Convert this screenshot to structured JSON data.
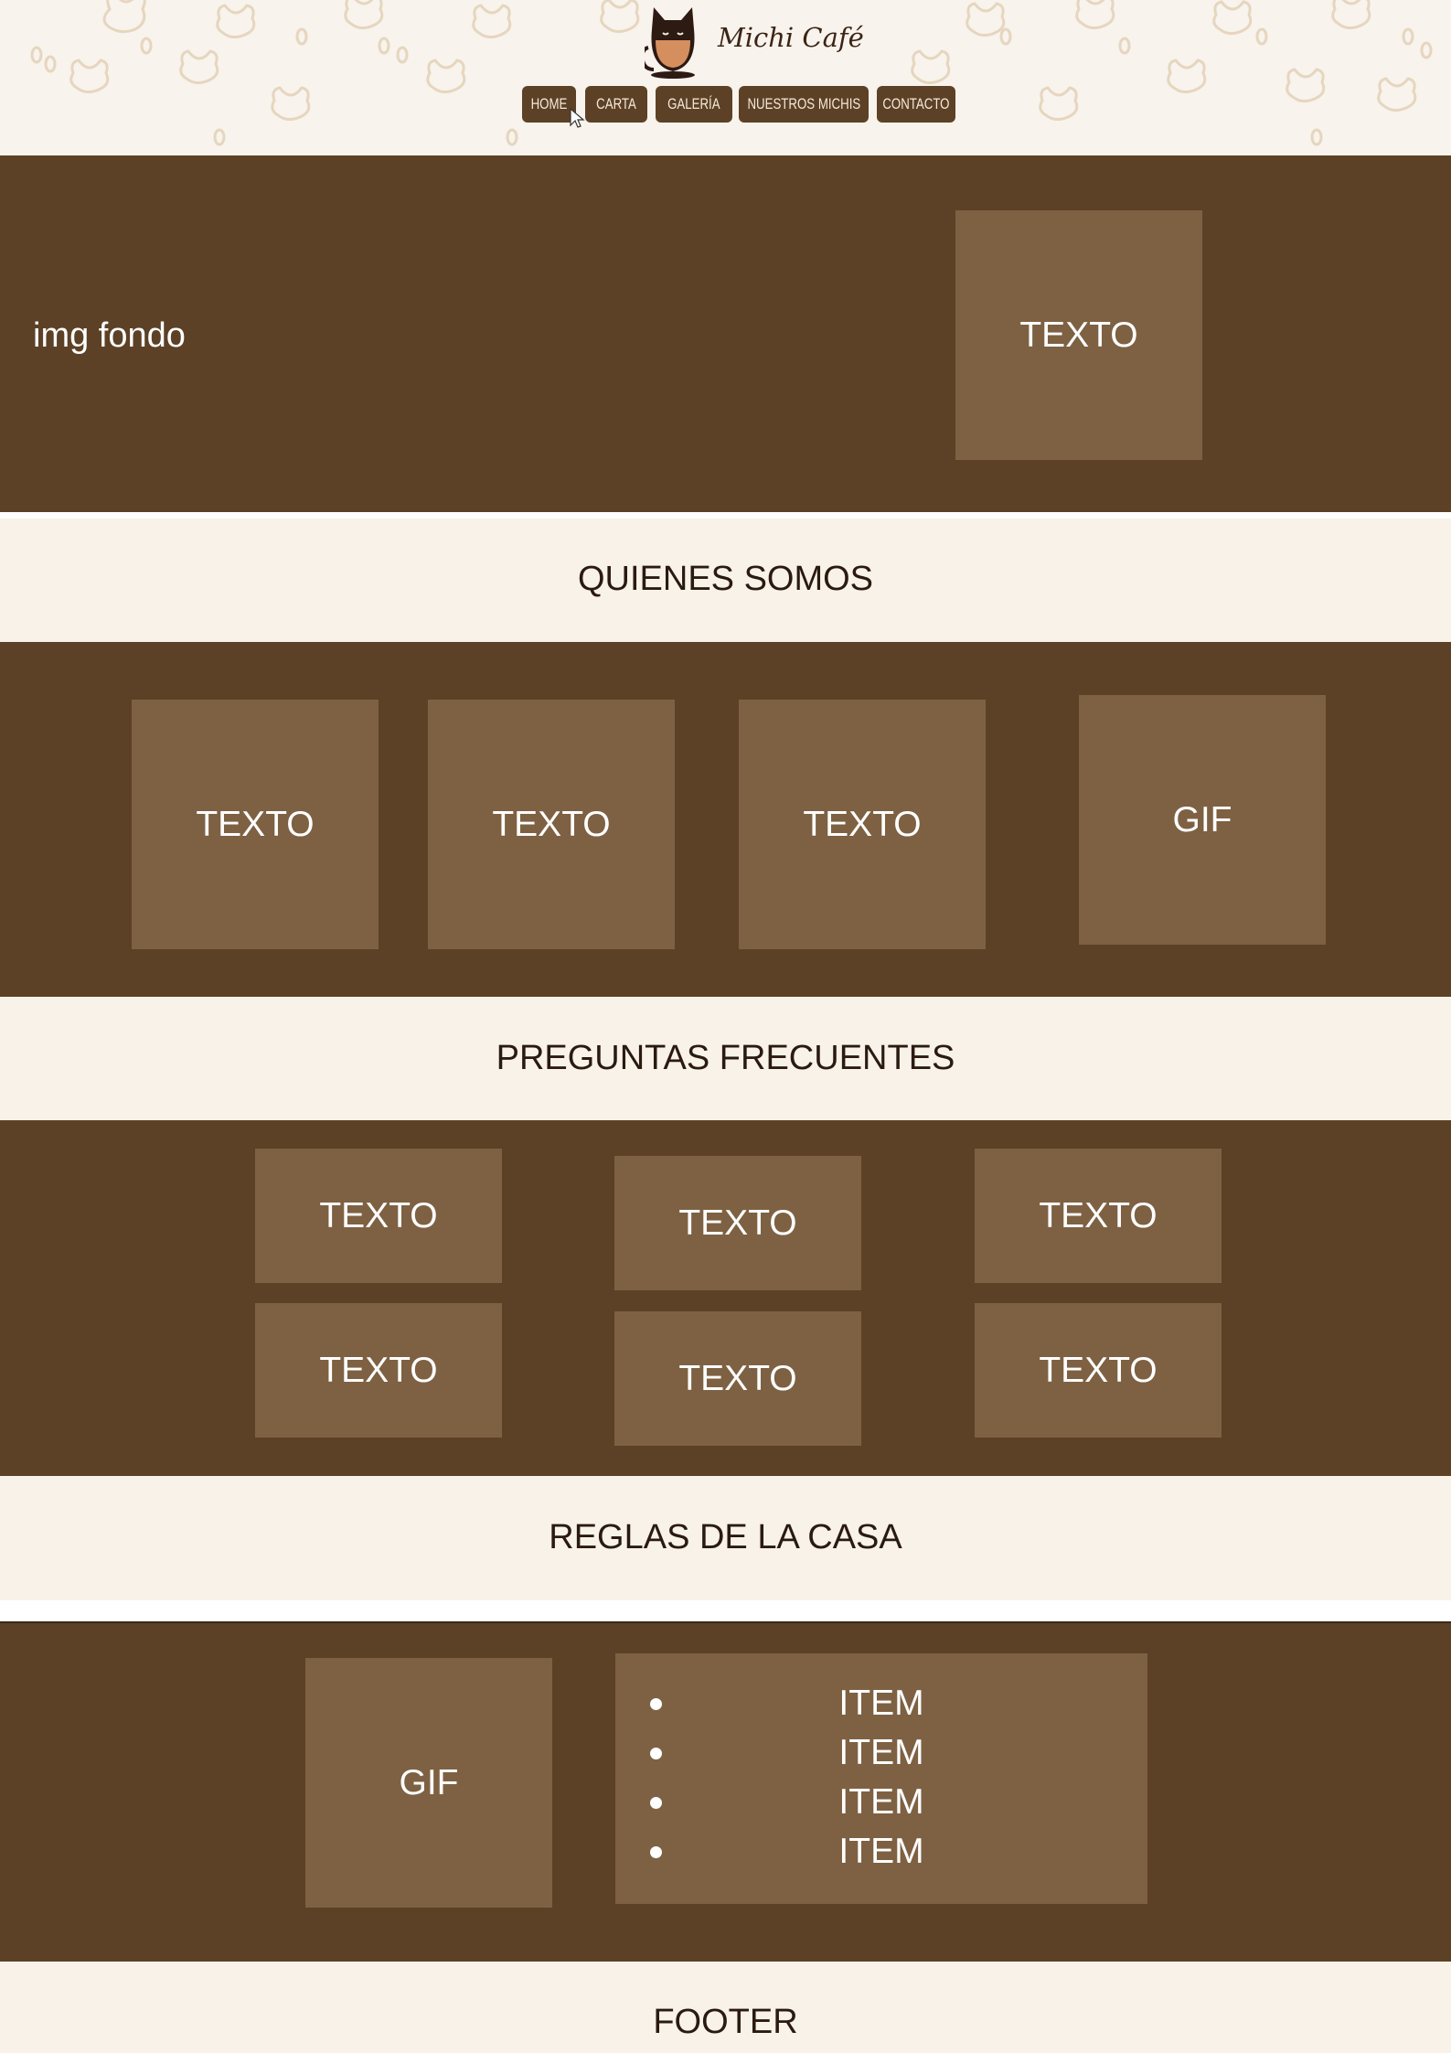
{
  "header": {
    "brand": "Michi Café",
    "nav": [
      "HOME",
      "CARTA",
      "GALERÍA",
      "NUESTROS MICHIS",
      "CONTACTO"
    ]
  },
  "hero": {
    "background_label": "img fondo",
    "box_label": "TEXTO"
  },
  "about": {
    "heading": "QUIENES SOMOS",
    "boxes": [
      "TEXTO",
      "TEXTO",
      "TEXTO",
      "GIF"
    ]
  },
  "faq": {
    "heading": "PREGUNTAS FRECUENTES",
    "boxes": [
      "TEXTO",
      "TEXTO",
      "TEXTO",
      "TEXTO",
      "TEXTO",
      "TEXTO"
    ]
  },
  "rules": {
    "heading": "REGLAS DE LA CASA",
    "gif_label": "GIF",
    "items": [
      "ITEM",
      "ITEM",
      "ITEM",
      "ITEM"
    ]
  },
  "footer": {
    "label": "FOOTER"
  },
  "colors": {
    "brown": "#5c4126",
    "box": "#7e6143",
    "cream": "#f8f2e8",
    "text_dark": "#2a1a10"
  },
  "icons": [
    "cat-cup-logo-icon",
    "mouse-pointer-icon"
  ]
}
